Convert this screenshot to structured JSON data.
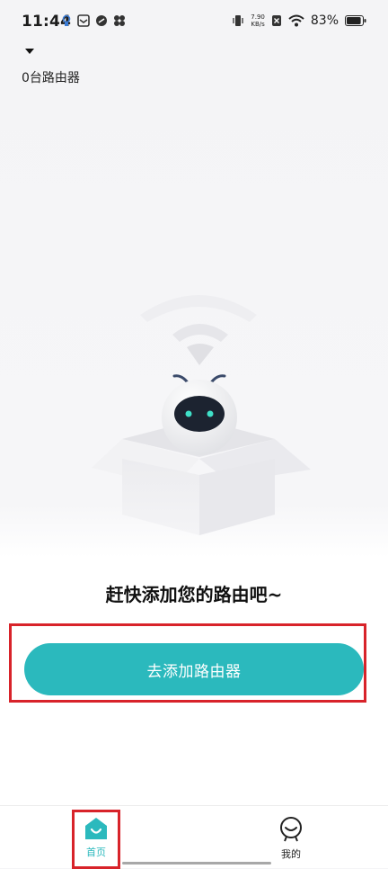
{
  "status_bar": {
    "time": "11:44",
    "speed_value": "7.90",
    "speed_unit": "KB/s",
    "battery": "83%",
    "icons": [
      "notification-icon",
      "mail-icon",
      "link-icon",
      "fan-icon",
      "vibrate-icon",
      "sim-off-icon",
      "wifi-icon",
      "battery-icon"
    ]
  },
  "header": {
    "router_count": "0台路由器"
  },
  "empty_state": {
    "title": "赶快添加您的路由吧~",
    "button_label": "去添加路由器"
  },
  "bottom_nav": {
    "items": [
      {
        "label": "首页",
        "icon": "home-icon",
        "active": true
      },
      {
        "label": "我的",
        "icon": "profile-icon",
        "active": false
      }
    ]
  },
  "colors": {
    "accent": "#2bb9bd",
    "highlight": "#d8232a"
  }
}
